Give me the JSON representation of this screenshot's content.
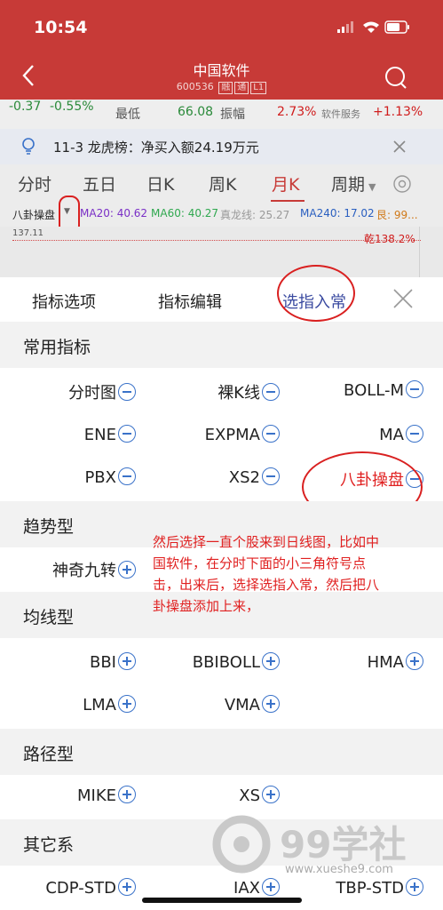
{
  "status": {
    "time": "10:54"
  },
  "header": {
    "title": "中国软件",
    "code": "600536",
    "tags": [
      "融",
      "通",
      "L1"
    ]
  },
  "quote_row": {
    "change": "-0.37",
    "change_pct": "-0.55%",
    "low_label": "最低",
    "low_value": "66.08",
    "amplitude_label": "振幅",
    "amplitude_value": "2.73%",
    "sector_label": "软件服务",
    "sector_pct": "+1.13%"
  },
  "notice": {
    "text": "11-3 龙虎榜：净买入额24.19万元"
  },
  "period_tabs": [
    "分时",
    "五日",
    "日K",
    "周K",
    "月K",
    "周期"
  ],
  "active_tab": "月K",
  "indicator_line": {
    "name": "八卦操盘",
    "ma20": "MA20: 40.62",
    "ma60": "MA60: 40.27",
    "zhenlong": "真龙线: 25.27",
    "ma240": "MA240: 17.02",
    "gen": "艮: 99...",
    "price_left": "137.11",
    "qian": "乾138.2%"
  },
  "sheet_tabs": {
    "options": "指标选项",
    "edit": "指标编辑",
    "select": "选指入常"
  },
  "sections": {
    "common": {
      "title": "常用指标",
      "items": [
        "分时图",
        "裸K线",
        "BOLL-M",
        "ENE",
        "EXPMA",
        "MA",
        "PBX",
        "XS2",
        "八卦操盘"
      ]
    },
    "trend": {
      "title": "趋势型",
      "items": [
        "神奇九转"
      ]
    },
    "ma": {
      "title": "均线型",
      "items": [
        "BBI",
        "BBIBOLL",
        "HMA",
        "LMA",
        "VMA"
      ]
    },
    "path": {
      "title": "路径型",
      "items": [
        "MIKE",
        "XS"
      ]
    },
    "other": {
      "title": "其它系",
      "items": [
        "CDP-STD",
        "IAX",
        "TBP-STD"
      ]
    }
  },
  "annotation": {
    "lines": [
      "然后选择一直个股来到日线图，比如中",
      "国软件，在分时下面的小三角符号点",
      "击，出来后，选择选指入常，然后把八",
      "卦操盘添加上来，"
    ]
  },
  "watermark": {
    "brand": "99学社",
    "url": "www.xueshe9.com"
  }
}
